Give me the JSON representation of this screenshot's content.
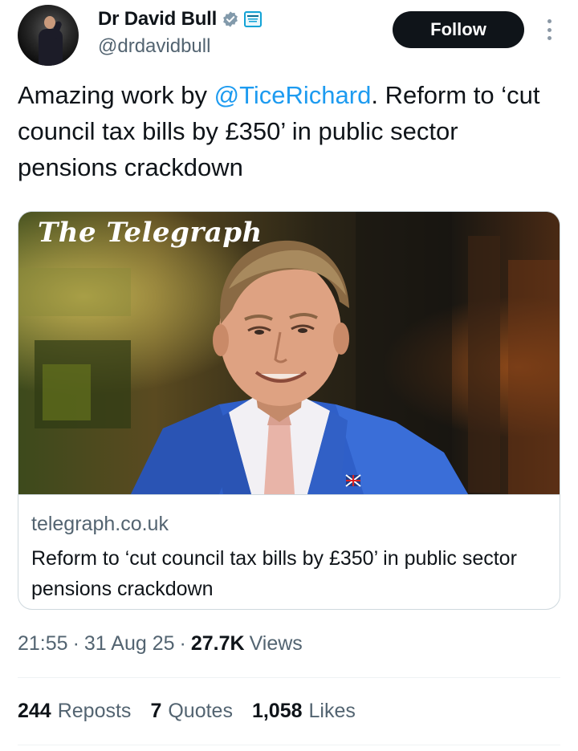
{
  "author": {
    "display_name": "Dr David Bull",
    "handle": "@drdavidbull",
    "avatar_icon": "profile-photo",
    "verified_icon": "verified-badge-icon",
    "affiliation_icon": "affiliate-badge-icon"
  },
  "header": {
    "follow_label": "Follow",
    "more_icon": "more-vertical-icon"
  },
  "tweet": {
    "text_before": "Amazing work by ",
    "mention": "@TiceRichard",
    "text_after": ". Reform to ‘cut council tax bills by £350’ in public sector pensions crackdown"
  },
  "card": {
    "masthead": "The Telegraph",
    "domain": "telegraph.co.uk",
    "title": "Reform to ‘cut council tax bills by £350’ in public sector pensions crackdown"
  },
  "meta": {
    "time": "21:55",
    "date": "31 Aug 25",
    "views_count": "27.7K",
    "views_label": "Views",
    "separator": "·"
  },
  "stats": {
    "reposts_count": "244",
    "reposts_label": "Reposts",
    "quotes_count": "7",
    "quotes_label": "Quotes",
    "likes_count": "1,058",
    "likes_label": "Likes"
  },
  "colors": {
    "link": "#1d9bf0",
    "secondary_text": "#536471",
    "primary_text": "#0f1419",
    "follow_bg": "#0f1419",
    "verified": "#829aab",
    "border": "#cfd9de"
  }
}
